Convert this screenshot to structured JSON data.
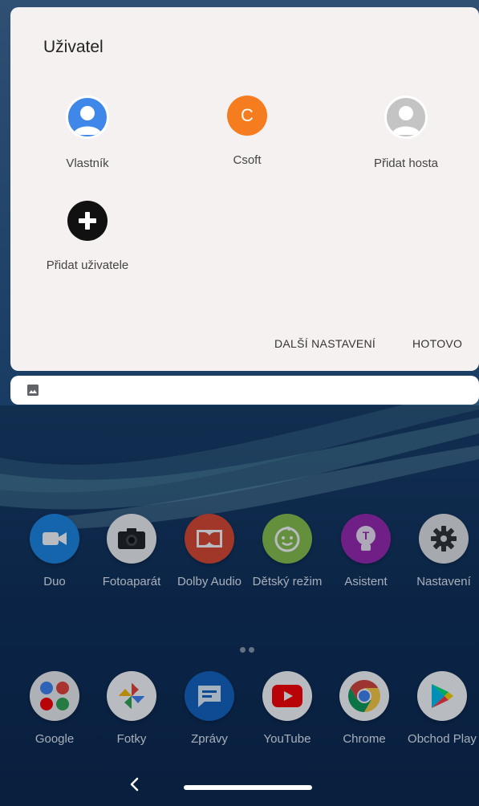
{
  "dialog": {
    "title": "Uživatel",
    "users": [
      {
        "label": "Vlastník",
        "icon": "user-avatar-icon",
        "color": "#3f87e8"
      },
      {
        "label": "Csoft",
        "icon": "letter-avatar",
        "letter": "C",
        "color": "#f57c1f"
      },
      {
        "label": "Přidat hosta",
        "icon": "guest-avatar-icon",
        "color": "#c4c4c4"
      }
    ],
    "add_user": {
      "label": "Přidat uživatele",
      "icon": "add-circle-icon"
    },
    "more_settings": "DALŠÍ NASTAVENÍ",
    "done": "HOTOVO"
  },
  "quick_settings": {
    "icon": "image-icon"
  },
  "apps_row1": [
    {
      "label": "Duo",
      "icon": "video-camera-icon",
      "color": "#1e88e5"
    },
    {
      "label": "Fotoaparát",
      "icon": "camera-icon",
      "color": "#f4f4f4"
    },
    {
      "label": "Dolby Audio",
      "icon": "dolby-icon",
      "color": "#e0492e"
    },
    {
      "label": "Dětský režim",
      "icon": "kids-face-icon",
      "color": "#8bc34a"
    },
    {
      "label": "Asistent",
      "icon": "assistant-bulb-icon",
      "color": "#9c27b0"
    },
    {
      "label": "Nastavení",
      "icon": "gear-icon",
      "color": "#e7e7e7"
    }
  ],
  "apps_row2": [
    {
      "label": "Google",
      "icon": "google-folder-icon",
      "color": "#f1f1f1"
    },
    {
      "label": "Fotky",
      "icon": "pinwheel-icon",
      "color": "#ffffff"
    },
    {
      "label": "Zprávy",
      "icon": "message-icon",
      "color": "#1565c0"
    },
    {
      "label": "YouTube",
      "icon": "youtube-icon",
      "color": "#ffffff"
    },
    {
      "label": "Chrome",
      "icon": "chrome-icon",
      "color": "#ffffff"
    },
    {
      "label": "Obchod Play",
      "icon": "play-store-icon",
      "color": "#ffffff"
    }
  ],
  "nav": {
    "back_icon": "back-chevron-icon",
    "home": "home-pill"
  }
}
